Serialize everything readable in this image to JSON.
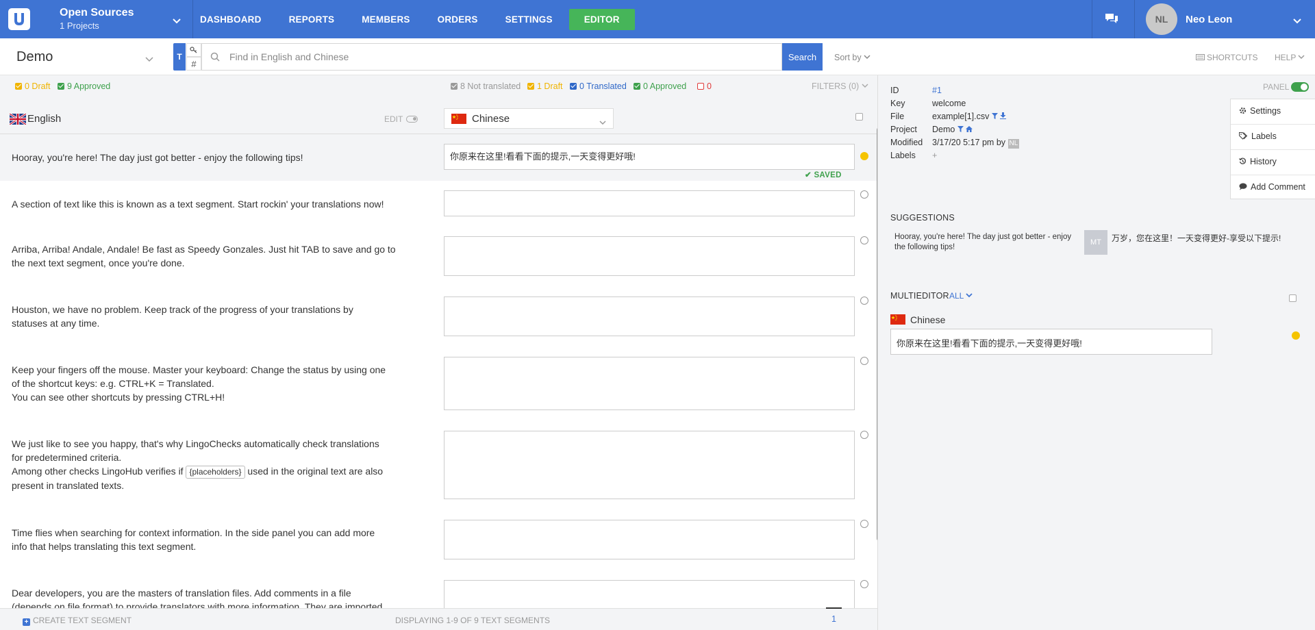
{
  "app": {
    "project_name": "Open Sources",
    "project_count": "1 Projects",
    "nav": [
      "DASHBOARD",
      "REPORTS",
      "MEMBERS",
      "ORDERS",
      "SETTINGS",
      "EDITOR"
    ],
    "user_initials": "NL",
    "user_name": "Neo Leon",
    "colors": {
      "brand": "#3f74d3",
      "active_nav": "#46b559",
      "draft": "#f0b400",
      "approved": "#3fa14d",
      "translated": "#2f68c8",
      "rejected": "#e03b3b"
    }
  },
  "toolbar": {
    "project": "Demo",
    "mode_t": "T",
    "mode_key_icon": "key-icon",
    "mode_hash": "#",
    "search_placeholder": "Find in English and Chinese",
    "search_button": "Search",
    "sort_by": "Sort by",
    "shortcuts": "SHORTCUTS",
    "help": "HELP"
  },
  "filters": {
    "source_draft": "0 Draft",
    "source_approved": "9 Approved",
    "not_translated": "8 Not translated",
    "draft": "1 Draft",
    "translated": "0 Translated",
    "approved": "0 Approved",
    "rejected": "0",
    "filters_label": "FILTERS (0)"
  },
  "languages": {
    "source": "English",
    "edit_label": "EDIT",
    "target": "Chinese"
  },
  "segments": [
    {
      "source": "Hooray, you're here! The day just got better - enjoy the following tips!",
      "target": "你原来在这里!看看下面的提示,一天变得更好哦!",
      "status": "draft",
      "saved": "SAVED"
    },
    {
      "source": "A section of text like this is known as a text segment. Start rockin' your translations now!",
      "target": "",
      "status": "empty"
    },
    {
      "source_lines": [
        "Arriba, Arriba! Andale, Andale! Be fast as Speedy Gonzales. Just hit TAB to save and go to",
        "the next text segment, once you're done."
      ],
      "target": "",
      "status": "empty"
    },
    {
      "source_lines": [
        "Houston, we have no problem. Keep track of the progress of your translations by",
        "statuses at any time."
      ],
      "target": "",
      "status": "empty"
    },
    {
      "source_lines": [
        "Keep your fingers off the mouse. Master your keyboard: Change the status by using one",
        "of the shortcut keys: e.g. CTRL+K = Translated.",
        "You can see other shortcuts by pressing CTRL+H!"
      ],
      "target": "",
      "status": "empty"
    },
    {
      "source_lines": [
        "We just like to see you happy, that's why LingoChecks automatically check translations",
        "for predetermined criteria."
      ],
      "source_pre": "Among other checks LingoHub verifies if",
      "placeholder": "{placeholders}",
      "source_post": "used in the original text are also",
      "source_last": "present in translated texts.",
      "target": "",
      "status": "empty"
    },
    {
      "source_lines": [
        "Time flies when searching for context information. In the side panel you can add more",
        "info that helps translating this text segment."
      ],
      "target": "",
      "status": "empty"
    },
    {
      "source_lines": [
        "Dear developers, you are the masters of translation files. Add comments in a file",
        "(depends on file format) to provide translators with more information. They are imported"
      ],
      "target": "",
      "status": "empty"
    }
  ],
  "footer": {
    "create": "CREATE TEXT SEGMENT",
    "displaying": "DISPLAYING 1-9 OF 9 TEXT SEGMENTS",
    "page": "1"
  },
  "panel": {
    "toggle_label": "PANEL",
    "meta": {
      "id_key": "ID",
      "id_val": "#1",
      "key_key": "Key",
      "key_val": "welcome",
      "file_key": "File",
      "file_val": "example[1].csv",
      "project_key": "Project",
      "project_val": "Demo",
      "modified_key": "Modified",
      "modified_val": "3/17/20 5:17 pm by",
      "modified_by": "NL",
      "labels_key": "Labels",
      "labels_val": "+"
    },
    "menu": [
      "Settings",
      "Labels",
      "History",
      "Add Comment"
    ],
    "suggestions_title": "SUGGESTIONS",
    "suggestion_source": "Hooray, you're here! The day just got better - enjoy the following tips!",
    "suggestion_badge": "MT",
    "suggestion_target": "万岁，您在这里！一天变得更好-享受以下提示!",
    "multieditor_title": "MULTIEDITOR",
    "multieditor_filter": "ALL",
    "multieditor_lang": "Chinese",
    "multieditor_text": "你原来在这里!看看下面的提示,一天变得更好哦!"
  }
}
